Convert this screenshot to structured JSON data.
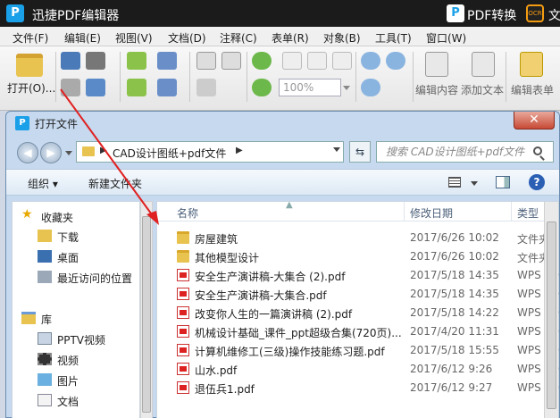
{
  "app": {
    "title": "迅捷PDF编辑器",
    "logo_letter": "P",
    "convert_label": "PDF转换",
    "ocr_badge": "OCR",
    "ocr_label": "文"
  },
  "menu": [
    "文件(F)",
    "编辑(E)",
    "视图(V)",
    "文档(D)",
    "注释(C)",
    "表单(R)",
    "对象(B)",
    "工具(T)",
    "窗口(W)"
  ],
  "toolbar": {
    "open_label": "打开(O)...",
    "zoom_value": "100%",
    "edit_content": "编辑内容",
    "add_text": "添加文本",
    "edit_form": "编辑表单"
  },
  "dialog": {
    "title": "打开文件",
    "close_glyph": "✕",
    "path": "CAD设计图纸+pdf文件",
    "search_placeholder": "搜索 CAD设计图纸+pdf文件",
    "organize": "组织 ▾",
    "new_folder": "新建文件夹",
    "help": "?"
  },
  "nav": {
    "favorites": "收藏夹",
    "downloads": "下载",
    "desktop": "桌面",
    "recent": "最近访问的位置",
    "libraries": "库",
    "pptv": "PPTV视频",
    "videos": "视频",
    "pictures": "图片",
    "documents": "文档"
  },
  "columns": {
    "name": "名称",
    "date": "修改日期",
    "type": "类型"
  },
  "files": [
    {
      "name": "房屋建筑",
      "date": "2017/6/26 10:02",
      "type": "文件夹",
      "kind": "folder"
    },
    {
      "name": "其他模型设计",
      "date": "2017/6/26 10:02",
      "type": "文件夹",
      "kind": "folder"
    },
    {
      "name": "安全生产演讲稿-大集合 (2).pdf",
      "date": "2017/5/18 14:35",
      "type": "WPS PDF",
      "kind": "pdf"
    },
    {
      "name": "安全生产演讲稿-大集合.pdf",
      "date": "2017/5/18 14:35",
      "type": "WPS PDF",
      "kind": "pdf"
    },
    {
      "name": "改变你人生的一篇演讲稿 (2).pdf",
      "date": "2017/5/18 14:22",
      "type": "WPS PDF",
      "kind": "pdf"
    },
    {
      "name": "机械设计基础_课件_ppt超级合集(720页)...",
      "date": "2017/4/20 11:31",
      "type": "WPS PDF",
      "kind": "pdf"
    },
    {
      "name": "计算机维修工(三级)操作技能练习题.pdf",
      "date": "2017/5/18 15:55",
      "type": "WPS PDF",
      "kind": "pdf"
    },
    {
      "name": "山水.pdf",
      "date": "2017/6/12 9:26",
      "type": "WPS PDF",
      "kind": "pdf"
    },
    {
      "name": "退伍兵1.pdf",
      "date": "2017/6/12 9:27",
      "type": "WPS PDF",
      "kind": "pdf"
    }
  ],
  "colors": {
    "titlebar": "#1b1b1b",
    "accent": "#1aa0e8",
    "annotation_arrow": "#e02020"
  }
}
